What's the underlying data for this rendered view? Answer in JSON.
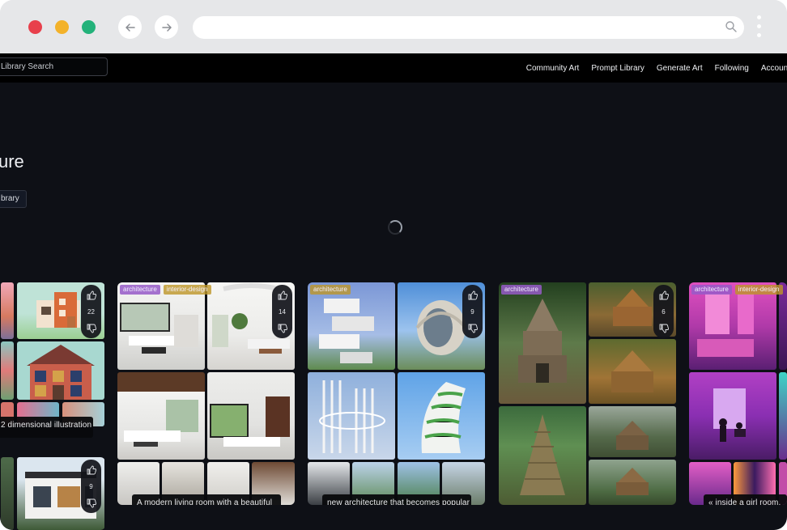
{
  "browser": {
    "back_icon": "arrow-left-icon",
    "forward_icon": "arrow-right-icon",
    "url": "",
    "search_icon": "search-icon",
    "menu_icon": "kebab-menu-icon"
  },
  "topbar": {
    "search_placeholder": "Library Search",
    "nav": [
      "Community Art",
      "Prompt Library",
      "Generate Art",
      "Following",
      "Account"
    ]
  },
  "hero": {
    "title": "ure",
    "button": "brary"
  },
  "cards": [
    {
      "tags": [],
      "votes": "22",
      "caption": "2 dimensional illustration"
    },
    {
      "tags": [],
      "votes": "9",
      "caption": ""
    },
    {
      "tags": [
        "architecture",
        "interior-design"
      ],
      "votes": "14",
      "caption": "A modern living room with a beautiful"
    },
    {
      "tags": [
        "architecture"
      ],
      "votes": "9",
      "caption": "new architecture that becomes popular"
    },
    {
      "tags": [
        "architecture"
      ],
      "votes": "6",
      "caption": ""
    },
    {
      "tags": [
        "architecture",
        "interior-design"
      ],
      "votes": "",
      "caption": "« inside a girl room,"
    }
  ],
  "colors": {
    "page_bg": "#0e1016",
    "topbar_bg": "#000000",
    "tag_purple": "#9a5ac8",
    "tag_gold": "#be9628"
  }
}
